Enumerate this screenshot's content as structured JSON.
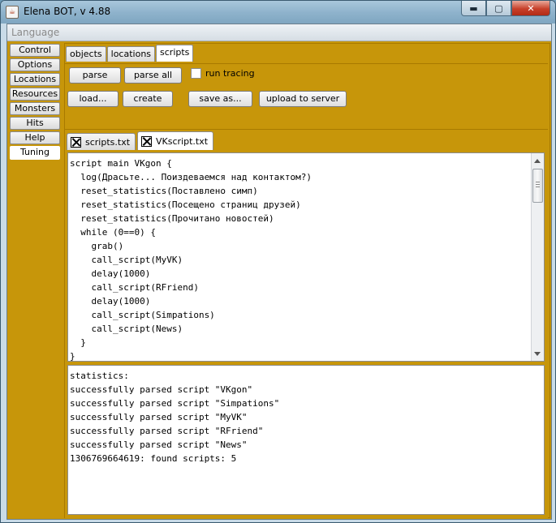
{
  "window": {
    "title": "Elena BOT, v 4.88",
    "app_icon": "java-cup-icon",
    "controls": {
      "minimize": "▬",
      "maximize": "▢",
      "close": "✕"
    }
  },
  "menubar": {
    "items": [
      "Language"
    ]
  },
  "sidebar": {
    "tabs": [
      "Control",
      "Options",
      "Locations",
      "Resources",
      "Monsters",
      "Hits",
      "Help",
      "Tuning"
    ],
    "active": "Tuning"
  },
  "top_tabs": {
    "tabs": [
      "objects",
      "locations",
      "scripts"
    ],
    "active": "scripts"
  },
  "toolbar": {
    "parse": "parse",
    "parse_all": "parse all",
    "run_tracing": "run tracing",
    "run_tracing_checked": false,
    "load": "load...",
    "create": "create",
    "save_as": "save as...",
    "upload": "upload to server"
  },
  "file_tabs": {
    "tabs": [
      "scripts.txt",
      "VKscript.txt"
    ],
    "active": "VKscript.txt",
    "close_icon": "close-box-icon"
  },
  "editor": {
    "lines": [
      "script main VKgon {",
      "  log(Драсьте... Поиздеваемся над контактом?)",
      "  reset_statistics(Поставлено симп)",
      "  reset_statistics(Посещено страниц друзей)",
      "  reset_statistics(Прочитано новостей)",
      "  while (0==0) {",
      "    grab()",
      "    call_script(MyVK)",
      "    delay(1000)",
      "    call_script(RFriend)",
      "    delay(1000)",
      "    call_script(Simpations)",
      "    call_script(News)",
      "  }",
      "}"
    ]
  },
  "output": {
    "lines": [
      "statistics:",
      "successfully parsed script \"VKgon\"",
      "successfully parsed script \"Simpations\"",
      "successfully parsed script \"MyVK\"",
      "successfully parsed script \"RFriend\"",
      "successfully parsed script \"News\"",
      "1306769664619: found scripts: 5"
    ]
  },
  "colors": {
    "panel_background": "#c7960a",
    "title_bar": "#8fb3cc"
  }
}
